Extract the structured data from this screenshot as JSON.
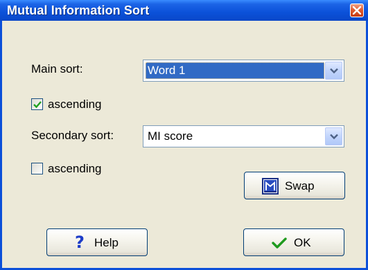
{
  "window": {
    "title": "Mutual Information Sort"
  },
  "main_sort": {
    "label": "Main sort:",
    "value": "Word 1"
  },
  "main_ascending": {
    "label": "ascending",
    "checked": true
  },
  "secondary_sort": {
    "label": "Secondary sort:",
    "value": "MI score"
  },
  "secondary_ascending": {
    "label": "ascending",
    "checked": false
  },
  "buttons": {
    "swap": "Swap",
    "help": "Help",
    "ok": "OK"
  },
  "icons": {
    "close": "close-icon",
    "dropdown": "chevron-down-icon",
    "check": "checkmark-icon",
    "swap": "swap-icon",
    "help": "question-mark-icon",
    "ok": "checkmark-icon"
  },
  "colors": {
    "titlebar": "#0b51d9",
    "selection": "#316ac5",
    "face": "#ece9d8",
    "check": "#21a121",
    "help": "#1c3cc8"
  }
}
